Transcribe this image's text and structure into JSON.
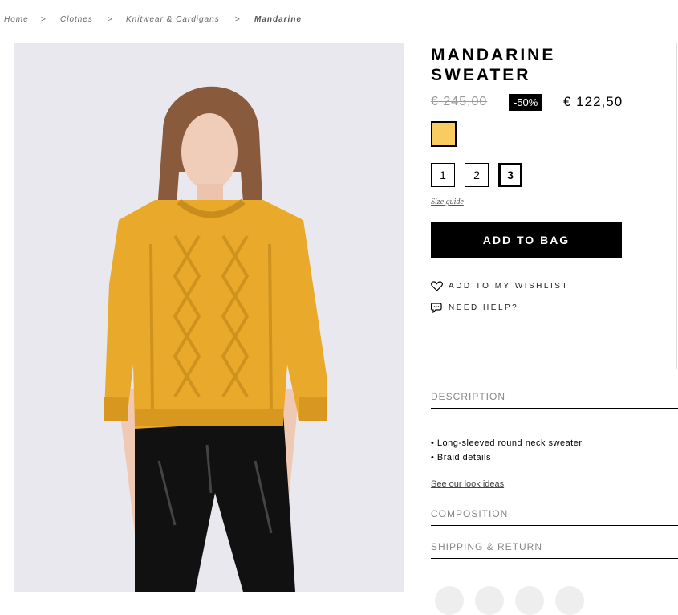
{
  "breadcrumb": {
    "items": [
      "Home",
      "Clothes",
      "Knitwear & Cardigans",
      "Mandarine"
    ],
    "separator": ">"
  },
  "product": {
    "title_line1": "MANDARINE",
    "title_line2": "SWEATER",
    "old_price": "€ 245,00",
    "discount": "-50%",
    "new_price": "€ 122,50",
    "color_swatch": "#f9cc62",
    "sizes": [
      "1",
      "2",
      "3"
    ],
    "selected_size": "3",
    "size_guide": "Size guide",
    "add_to_bag": "ADD TO BAG",
    "wishlist": "ADD TO MY WISHLIST",
    "help": "NEED HELP?"
  },
  "accordion": {
    "description": "DESCRIPTION",
    "description_items": [
      "Long-sleeved round neck sweater",
      "Braid details"
    ],
    "look_ideas": "See our look ideas",
    "composition": "COMPOSITION",
    "shipping": "SHIPPING & RETURN"
  },
  "colors": {
    "sweater": "#e9a92a",
    "background": "#e9e8ef",
    "pants": "#111111"
  },
  "icons": [
    "heart-icon",
    "chat-bubble-icon"
  ]
}
